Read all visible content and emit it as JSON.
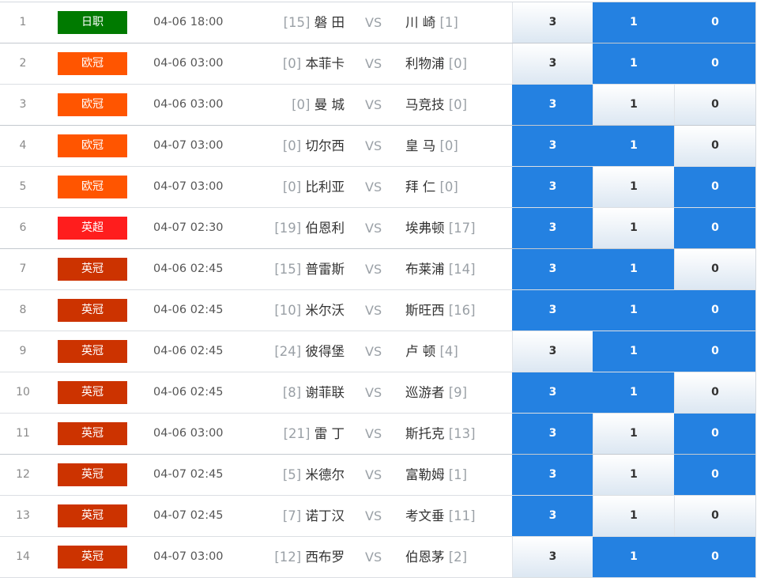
{
  "colors": {
    "selected_cell": "#2481e1",
    "league_riz": "#007a00",
    "league_ouguan": "#ff5500",
    "league_yingchao": "#ff1d1d",
    "league_yingguan": "#cc3300"
  },
  "matches": [
    {
      "num": "1",
      "league": "日职",
      "league_color": "#007a00",
      "time": "04-06 18:00",
      "home_rank": "[15]",
      "home": "磐 田",
      "vs": "VS",
      "away": "川 崎",
      "away_rank": "[1]",
      "options": [
        "3",
        "1",
        "0"
      ],
      "selected": [
        false,
        true,
        true
      ]
    },
    {
      "num": "2",
      "league": "欧冠",
      "league_color": "#ff5500",
      "time": "04-06 03:00",
      "home_rank": "[0]",
      "home": "本菲卡",
      "vs": "VS",
      "away": "利物浦",
      "away_rank": "[0]",
      "options": [
        "3",
        "1",
        "0"
      ],
      "selected": [
        false,
        true,
        true
      ]
    },
    {
      "num": "3",
      "league": "欧冠",
      "league_color": "#ff5500",
      "time": "04-06 03:00",
      "home_rank": "[0]",
      "home": "曼 城",
      "vs": "VS",
      "away": "马竞技",
      "away_rank": "[0]",
      "options": [
        "3",
        "1",
        "0"
      ],
      "selected": [
        true,
        false,
        false
      ]
    },
    {
      "num": "4",
      "league": "欧冠",
      "league_color": "#ff5500",
      "time": "04-07 03:00",
      "home_rank": "[0]",
      "home": "切尔西",
      "vs": "VS",
      "away": "皇 马",
      "away_rank": "[0]",
      "options": [
        "3",
        "1",
        "0"
      ],
      "selected": [
        true,
        true,
        false
      ]
    },
    {
      "num": "5",
      "league": "欧冠",
      "league_color": "#ff5500",
      "time": "04-07 03:00",
      "home_rank": "[0]",
      "home": "比利亚",
      "vs": "VS",
      "away": "拜 仁",
      "away_rank": "[0]",
      "options": [
        "3",
        "1",
        "0"
      ],
      "selected": [
        true,
        false,
        true
      ]
    },
    {
      "num": "6",
      "league": "英超",
      "league_color": "#ff1d1d",
      "time": "04-07 02:30",
      "home_rank": "[19]",
      "home": "伯恩利",
      "vs": "VS",
      "away": "埃弗顿",
      "away_rank": "[17]",
      "options": [
        "3",
        "1",
        "0"
      ],
      "selected": [
        true,
        false,
        true
      ]
    },
    {
      "num": "7",
      "league": "英冠",
      "league_color": "#cc3300",
      "time": "04-06 02:45",
      "home_rank": "[15]",
      "home": "普雷斯",
      "vs": "VS",
      "away": "布莱浦",
      "away_rank": "[14]",
      "options": [
        "3",
        "1",
        "0"
      ],
      "selected": [
        true,
        true,
        false
      ]
    },
    {
      "num": "8",
      "league": "英冠",
      "league_color": "#cc3300",
      "time": "04-06 02:45",
      "home_rank": "[10]",
      "home": "米尔沃",
      "vs": "VS",
      "away": "斯旺西",
      "away_rank": "[16]",
      "options": [
        "3",
        "1",
        "0"
      ],
      "selected": [
        true,
        true,
        true
      ]
    },
    {
      "num": "9",
      "league": "英冠",
      "league_color": "#cc3300",
      "time": "04-06 02:45",
      "home_rank": "[24]",
      "home": "彼得堡",
      "vs": "VS",
      "away": "卢 顿",
      "away_rank": "[4]",
      "options": [
        "3",
        "1",
        "0"
      ],
      "selected": [
        false,
        true,
        true
      ]
    },
    {
      "num": "10",
      "league": "英冠",
      "league_color": "#cc3300",
      "time": "04-06 02:45",
      "home_rank": "[8]",
      "home": "谢菲联",
      "vs": "VS",
      "away": "巡游者",
      "away_rank": "[9]",
      "options": [
        "3",
        "1",
        "0"
      ],
      "selected": [
        true,
        true,
        false
      ]
    },
    {
      "num": "11",
      "league": "英冠",
      "league_color": "#cc3300",
      "time": "04-06 03:00",
      "home_rank": "[21]",
      "home": "雷 丁",
      "vs": "VS",
      "away": "斯托克",
      "away_rank": "[13]",
      "options": [
        "3",
        "1",
        "0"
      ],
      "selected": [
        true,
        false,
        true
      ]
    },
    {
      "num": "12",
      "league": "英冠",
      "league_color": "#cc3300",
      "time": "04-07 02:45",
      "home_rank": "[5]",
      "home": "米德尔",
      "vs": "VS",
      "away": "富勒姆",
      "away_rank": "[1]",
      "options": [
        "3",
        "1",
        "0"
      ],
      "selected": [
        true,
        false,
        true
      ]
    },
    {
      "num": "13",
      "league": "英冠",
      "league_color": "#cc3300",
      "time": "04-07 02:45",
      "home_rank": "[7]",
      "home": "诺丁汉",
      "vs": "VS",
      "away": "考文垂",
      "away_rank": "[11]",
      "options": [
        "3",
        "1",
        "0"
      ],
      "selected": [
        true,
        false,
        false
      ]
    },
    {
      "num": "14",
      "league": "英冠",
      "league_color": "#cc3300",
      "time": "04-07 03:00",
      "home_rank": "[12]",
      "home": "西布罗",
      "vs": "VS",
      "away": "伯恩茅",
      "away_rank": "[2]",
      "options": [
        "3",
        "1",
        "0"
      ],
      "selected": [
        false,
        true,
        true
      ]
    }
  ]
}
